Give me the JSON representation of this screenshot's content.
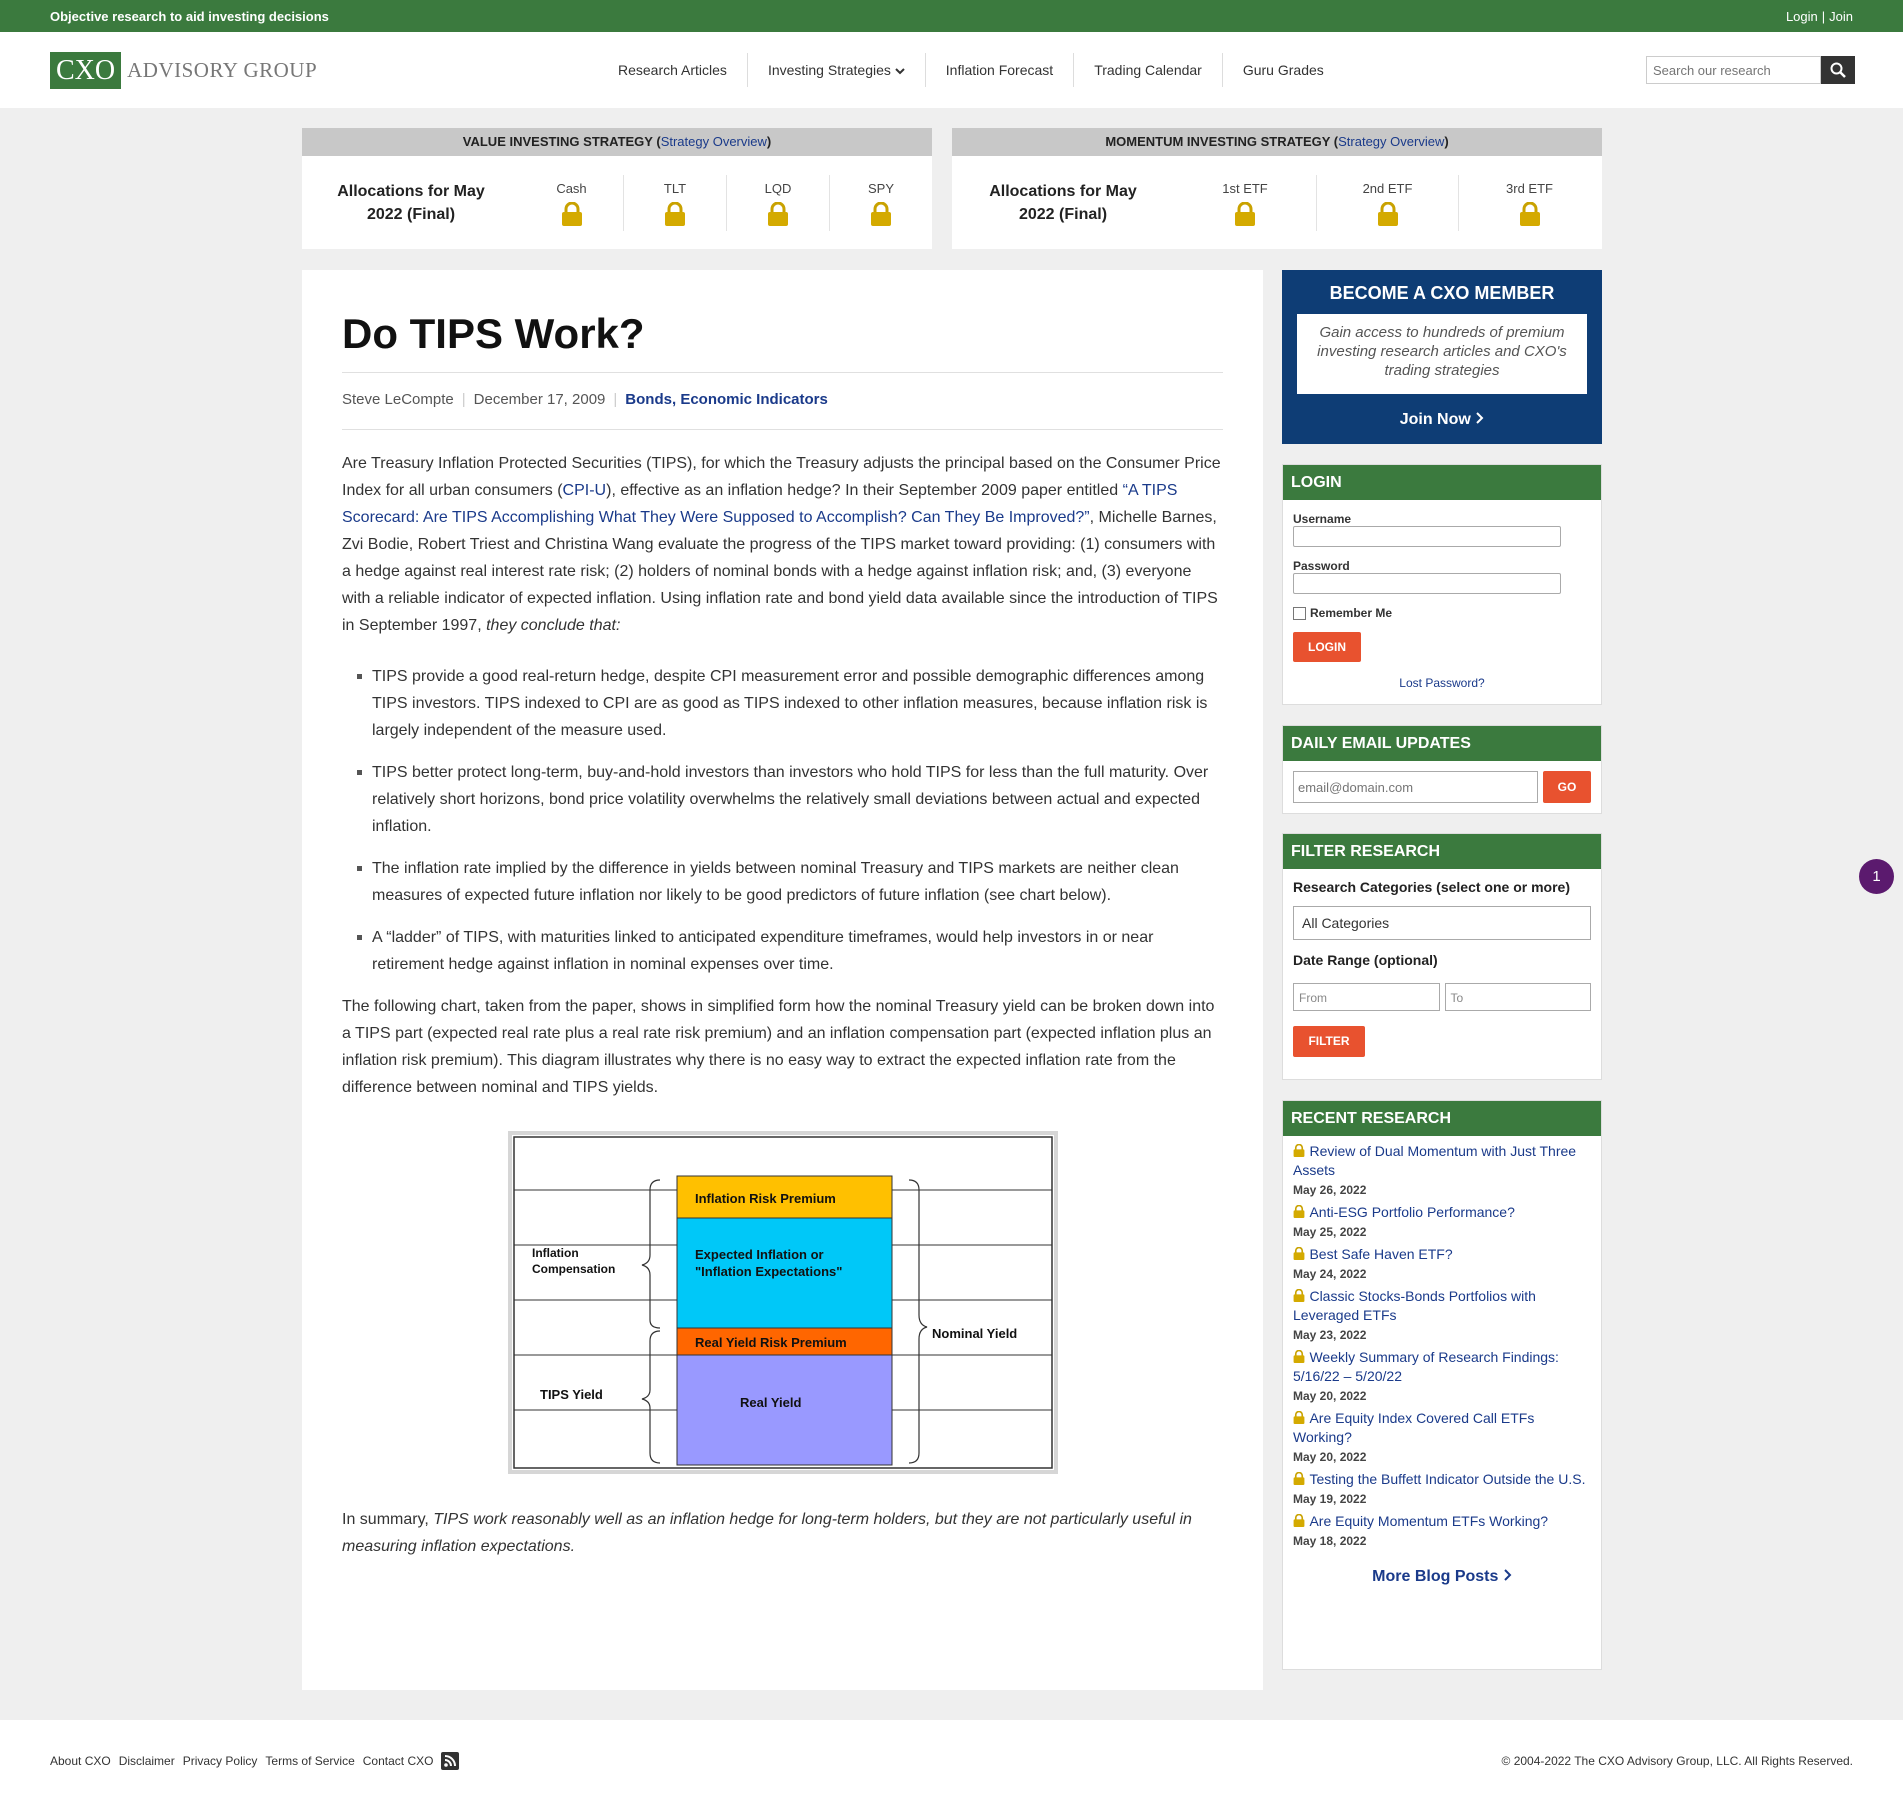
{
  "topbar": {
    "tagline": "Objective research to aid investing decisions",
    "login": "Login",
    "sep": "|",
    "join": "Join"
  },
  "logo": {
    "box": "CXO",
    "text": "ADVISORY GROUP"
  },
  "nav": [
    "Research Articles",
    "Investing Strategies",
    "Inflation Forecast",
    "Trading Calendar",
    "Guru Grades"
  ],
  "search": {
    "placeholder": "Search our research"
  },
  "value_strategy": {
    "title": "VALUE INVESTING STRATEGY",
    "link": "Strategy Overview",
    "alloc": "Allocations for May 2022 (Final)",
    "cols": [
      "Cash",
      "TLT",
      "LQD",
      "SPY"
    ]
  },
  "momentum_strategy": {
    "title": "MOMENTUM INVESTING STRATEGY",
    "link": "Strategy Overview",
    "alloc": "Allocations for May 2022 (Final)",
    "cols": [
      "1st ETF",
      "2nd ETF",
      "3rd ETF"
    ]
  },
  "article": {
    "title": "Do TIPS Work?",
    "author": "Steve LeCompte",
    "date": "December 17, 2009",
    "cat1": "Bonds",
    "cat2": "Economic Indicators",
    "p1a": "Are Treasury Inflation Protected Securities (TIPS), for which the Treasury adjusts the principal based on the Consumer Price Index for all urban consumers (",
    "p1link1": "CPI-U",
    "p1b": "), effective as an inflation hedge? In their September 2009 paper entitled ",
    "p1link2": "“A TIPS Scorecard: Are TIPS Accomplishing What They Were Supposed to Accomplish? Can They Be Improved?”",
    "p1c": ", Michelle Barnes, Zvi Bodie, Robert Triest and Christina Wang evaluate the progress of the TIPS market toward providing: (1) consumers with a hedge against real interest rate risk; (2) holders of nominal bonds with a hedge against inflation risk; and, (3) everyone with a reliable indicator of expected inflation. Using inflation rate and bond yield data available since the introduction of TIPS in September 1997, ",
    "p1d": "they conclude that:",
    "bullets": [
      "TIPS provide a good real-return hedge, despite CPI measurement error and possible demographic differences among TIPS investors. TIPS indexed to CPI are as good as TIPS indexed to other inflation measures, because inflation risk is largely independent of the measure used.",
      "TIPS better protect long-term, buy-and-hold investors than investors who hold TIPS for less than the full maturity. Over relatively short horizons, bond price volatility overwhelms the relatively small deviations between actual and expected inflation.",
      "The inflation rate implied by the difference in yields between nominal Treasury and TIPS markets are neither clean measures of expected future inflation nor likely to be good predictors of future inflation (see chart below).",
      "A “ladder” of TIPS, with maturities linked to anticipated expenditure timeframes, would help investors in or near retirement hedge against inflation in nominal expenses over time."
    ],
    "p2": "The following chart, taken from the paper, shows in simplified form how the nominal Treasury yield can be broken down into a TIPS part (expected real rate plus a real rate risk premium) and an inflation compensation part (expected inflation plus an inflation risk premium). This diagram illustrates why there is no easy way to extract the expected inflation rate from the difference between nominal and TIPS yields.",
    "p3a": "In summary, ",
    "p3b": "TIPS work reasonably well as an inflation hedge for long-term holders, but they are not particularly useful in measuring inflation expectations."
  },
  "diagram": {
    "irp": "Inflation Risk Premium",
    "ei1": "Expected Inflation or",
    "ei2": "\"Inflation Expectations\"",
    "ryrp": "Real Yield Risk Premium",
    "ry": "Real Yield",
    "ic1": "Inflation",
    "ic2": "Compensation",
    "tips": "TIPS Yield",
    "nominal": "Nominal Yield",
    "colors": {
      "irp": "#ffc000",
      "ei": "#00c8f8",
      "ryrp": "#ff6600",
      "ry": "#9999ff"
    }
  },
  "member": {
    "title": "BECOME A CXO MEMBER",
    "desc": "Gain access to hundreds of premium investing research articles and CXO's trading strategies",
    "join": "Join Now"
  },
  "login": {
    "title": "LOGIN",
    "username": "Username",
    "password": "Password",
    "remember": "Remember Me",
    "button": "LOGIN",
    "lost": "Lost Password?"
  },
  "email": {
    "title": "DAILY EMAIL UPDATES",
    "placeholder": "email@domain.com",
    "button": "GO"
  },
  "filter": {
    "title": "FILTER RESEARCH",
    "cat_label": "Research Categories (select one or more)",
    "cat_value": "All Categories",
    "date_label": "Date Range (optional)",
    "from": "From",
    "to": "To",
    "button": "FILTER"
  },
  "recent": {
    "title": "RECENT RESEARCH",
    "items": [
      {
        "title": "Review of Dual Momentum with Just Three Assets",
        "date": "May 26, 2022"
      },
      {
        "title": "Anti-ESG Portfolio Performance?",
        "date": "May 25, 2022"
      },
      {
        "title": "Best Safe Haven ETF?",
        "date": "May 24, 2022"
      },
      {
        "title": "Classic Stocks-Bonds Portfolios with Leveraged ETFs",
        "date": "May 23, 2022"
      },
      {
        "title": "Weekly Summary of Research Findings: 5/16/22 – 5/20/22",
        "date": "May 20, 2022"
      },
      {
        "title": "Are Equity Index Covered Call ETFs Working?",
        "date": "May 20, 2022"
      },
      {
        "title": "Testing the Buffett Indicator Outside the U.S.",
        "date": "May 19, 2022"
      },
      {
        "title": "Are Equity Momentum ETFs Working?",
        "date": "May 18, 2022"
      }
    ],
    "more": "More Blog Posts"
  },
  "footer": {
    "links": [
      "About CXO",
      "Disclaimer",
      "Privacy Policy",
      "Terms of Service",
      "Contact CXO"
    ],
    "copyright": "© 2004-2022 The CXO Advisory Group, LLC. All Rights Reserved."
  },
  "badge": "1"
}
